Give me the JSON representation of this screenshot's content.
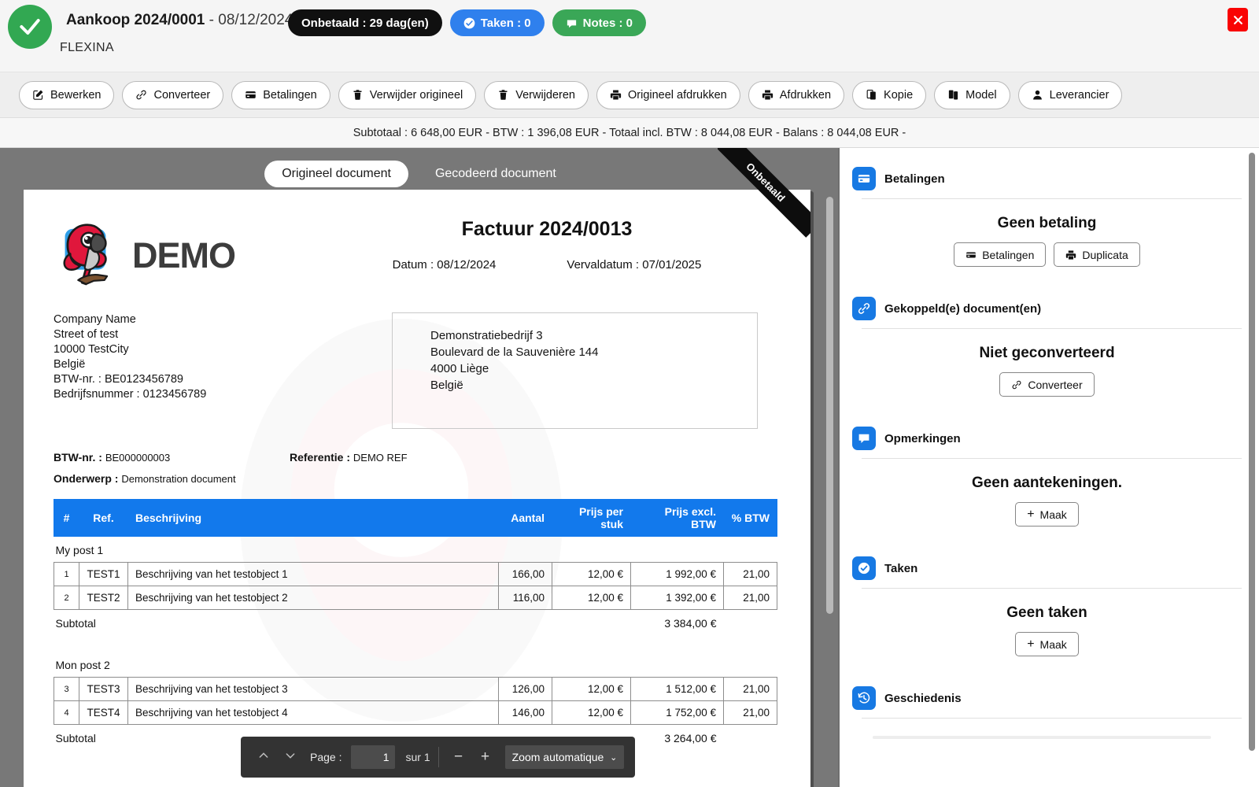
{
  "header": {
    "status_icon": "check-circle-icon",
    "doc_ref": "Aankoop 2024/0001",
    "doc_date": " - 08/12/2024",
    "supplier": "FLEXINA",
    "badges": [
      {
        "label": "Onbetaald : 29 dag(en)",
        "style": "dark",
        "icon": ""
      },
      {
        "label": "Taken : 0",
        "style": "blue",
        "icon": "check-badge-icon"
      },
      {
        "label": "Notes : 0",
        "style": "green",
        "icon": "comment-icon"
      }
    ],
    "close_label": "close-icon"
  },
  "toolbar": {
    "buttons": [
      {
        "label": "Bewerken",
        "icon": "pencil-square-icon"
      },
      {
        "label": "Converteer",
        "icon": "link-icon"
      },
      {
        "label": "Betalingen",
        "icon": "credit-card-icon"
      },
      {
        "label": "Verwijder origineel",
        "icon": "trash-icon"
      },
      {
        "label": "Verwijderen",
        "icon": "trash-icon"
      },
      {
        "label": "Origineel afdrukken",
        "icon": "printer-icon"
      },
      {
        "label": "Afdrukken",
        "icon": "printer-icon"
      },
      {
        "label": "Kopie",
        "icon": "copy-icon"
      },
      {
        "label": "Model",
        "icon": "documents-icon"
      },
      {
        "label": "Leverancier",
        "icon": "user-icon"
      }
    ]
  },
  "totals_bar": "Subtotaal : 6 648,00 EUR - BTW : 1 396,08 EUR - Totaal incl. BTW : 8 044,08 EUR - Balans : 8 044,08 EUR -",
  "viewer": {
    "tabs": [
      {
        "label": "Origineel document",
        "active": true
      },
      {
        "label": "Gecodeerd document",
        "active": false
      }
    ],
    "ribbon": "Onbetaald",
    "pdfbar": {
      "prev_icon": "chevron-up-icon",
      "next_icon": "chevron-down-icon",
      "page_label": "Page :",
      "page_value": "1",
      "page_total": "sur 1",
      "zoom_out": "−",
      "zoom_in": "+",
      "zoom_value": "Zoom automatique"
    }
  },
  "invoice": {
    "logo_text": "DEMO",
    "title": "Factuur 2024/0013",
    "date_label": "Datum : 08/12/2024",
    "duedate_label": "Vervaldatum : 07/01/2025",
    "sender": [
      "Company Name",
      "Street of test",
      "10000 TestCity",
      "België",
      "BTW-nr. : BE0123456789",
      "Bedrijfsnummer : 0123456789"
    ],
    "recipient": [
      "Demonstratiebedrijf 3",
      "Boulevard de la Sauvenière 144",
      "4000 Liège",
      "België"
    ],
    "meta": {
      "vat_label": "BTW-nr. :",
      "vat_value": "BE000000003",
      "ref_label": "Referentie :",
      "ref_value": "DEMO REF",
      "subject_label": "Onderwerp :",
      "subject_value": "Demonstration document"
    },
    "table": {
      "columns": [
        "#",
        "Ref.",
        "Beschrijving",
        "Aantal",
        "Prijs per stuk",
        "Prijs excl. BTW",
        "% BTW"
      ],
      "groups": [
        {
          "title": "My post 1",
          "rows": [
            {
              "num": "1",
              "ref": "TEST1",
              "desc": "Beschrijving van het testobject 1",
              "qty": "166,00",
              "unit": "12,00 €",
              "excl": "1 992,00 €",
              "vat": "21,00"
            },
            {
              "num": "2",
              "ref": "TEST2",
              "desc": "Beschrijving van het testobject 2",
              "qty": "116,00",
              "unit": "12,00 €",
              "excl": "1 392,00 €",
              "vat": "21,00"
            }
          ],
          "subtotal_label": "Subtotal",
          "subtotal_value": "3 384,00 €"
        },
        {
          "title": "Mon post 2",
          "rows": [
            {
              "num": "3",
              "ref": "TEST3",
              "desc": "Beschrijving van het testobject 3",
              "qty": "126,00",
              "unit": "12,00 €",
              "excl": "1 512,00 €",
              "vat": "21,00"
            },
            {
              "num": "4",
              "ref": "TEST4",
              "desc": "Beschrijving van het testobject 4",
              "qty": "146,00",
              "unit": "12,00 €",
              "excl": "1 752,00 €",
              "vat": "21,00"
            }
          ],
          "subtotal_label": "Subtotal",
          "subtotal_value": "3 264,00 €"
        }
      ]
    }
  },
  "sidebar": {
    "sections": [
      {
        "title": "Betalingen",
        "icon": "credit-card-icon",
        "message": "Geen betaling",
        "actions": [
          {
            "label": "Betalingen",
            "icon": "credit-card-icon"
          },
          {
            "label": "Duplicata",
            "icon": "printer-icon"
          }
        ]
      },
      {
        "title": "Gekoppeld(e) document(en)",
        "icon": "link-icon",
        "message": "Niet geconverteerd",
        "actions": [
          {
            "label": "Converteer",
            "icon": "link-icon"
          }
        ]
      },
      {
        "title": "Opmerkingen",
        "icon": "comment-icon",
        "message": "Geen aantekeningen.",
        "actions": [
          {
            "label": "Maak",
            "icon": "plus-icon"
          }
        ]
      },
      {
        "title": "Taken",
        "icon": "check-badge-icon",
        "message": "Geen taken",
        "actions": [
          {
            "label": "Maak",
            "icon": "plus-icon"
          }
        ]
      },
      {
        "title": "Geschiedenis",
        "icon": "history-icon",
        "message": "",
        "actions": []
      }
    ]
  },
  "colors": {
    "accent_blue": "#1779e3",
    "table_header_blue": "#1279ec",
    "green": "#32a852",
    "badge_dark": "#101010",
    "danger_red": "#f90303",
    "viewer_bg": "#787878"
  }
}
